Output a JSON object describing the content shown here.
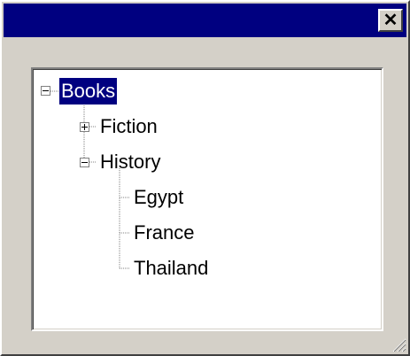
{
  "window": {
    "title": "",
    "close_icon": "close-icon",
    "colors": {
      "titlebar": "#000080",
      "face": "#d4d0c8",
      "selection": "#000080"
    }
  },
  "tree": {
    "root": {
      "label": "Books",
      "expanded": true,
      "selected": true
    },
    "children": [
      {
        "label": "Fiction",
        "expanded": false
      },
      {
        "label": "History",
        "expanded": true,
        "children": [
          {
            "label": "Egypt"
          },
          {
            "label": "France"
          },
          {
            "label": "Thailand"
          }
        ]
      }
    ]
  }
}
